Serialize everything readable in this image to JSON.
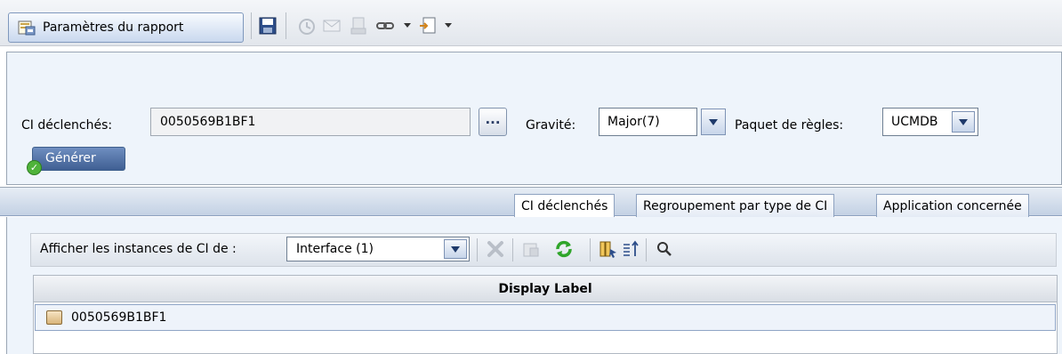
{
  "toolbar": {
    "report_settings_label": "Paramètres du rapport",
    "icons": [
      "save-icon",
      "schedule-icon",
      "email-icon",
      "export-icon",
      "link-icon",
      "chevron-down-icon",
      "import-icon",
      "chevron-down-icon"
    ]
  },
  "params": {
    "ci_label": "CI déclenchés:",
    "ci_value": "0050569B1BF1",
    "dots_label": "...",
    "severity_label": "Gravité:",
    "severity_value": "Major(7)",
    "rules_label": "Paquet de règles:",
    "rules_value": "UCMDB",
    "generate_label": "Générer"
  },
  "tabs": [
    {
      "label": "CI déclenchés",
      "active": true
    },
    {
      "label": "Regroupement par type de CI",
      "active": false
    },
    {
      "label": "Application concernée",
      "active": false
    }
  ],
  "instances": {
    "label": "Afficher les instances de CI de :",
    "value": "Interface (1)"
  },
  "table": {
    "column_header": "Display Label",
    "rows": [
      {
        "label": "0050569B1BF1"
      }
    ]
  },
  "colors": {
    "panel_bg": "#eef4fb",
    "generate_btn": "#4a6aa0",
    "refresh_green": "#2fa52a"
  }
}
